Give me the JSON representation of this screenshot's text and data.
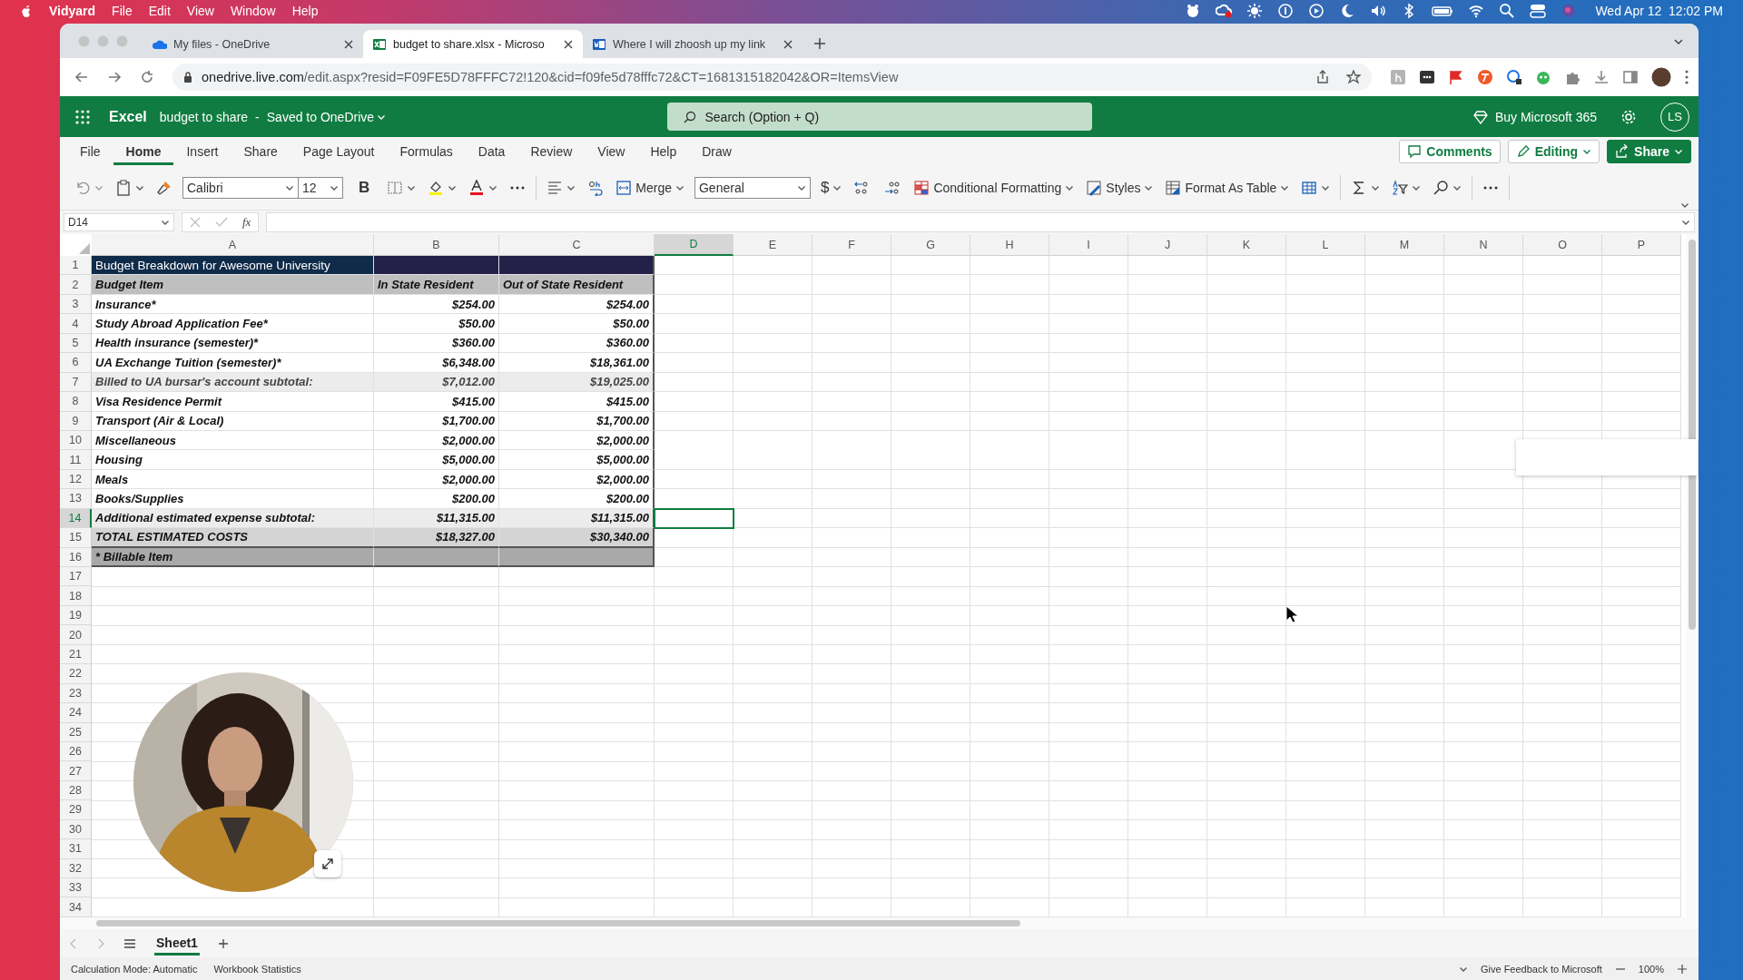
{
  "menubar": {
    "app": "Vidyard",
    "items": [
      "File",
      "Edit",
      "View",
      "Window",
      "Help"
    ],
    "clock": "Wed Apr 12  12:02 PM"
  },
  "browser": {
    "tabs": [
      {
        "title": "My files - OneDrive",
        "kind": "cloud",
        "selected": false
      },
      {
        "title": "budget to share.xlsx - Microso",
        "kind": "sheet",
        "selected": true
      },
      {
        "title": "Where I will zhoosh up my link",
        "kind": "doc",
        "selected": false
      }
    ],
    "url_host": "onedrive.live.com",
    "url_path": "/edit.aspx?resid=F09FE5D78FFFC72!120&cid=f09fe5d78fffc72&CT=1681315182042&OR=ItemsView"
  },
  "excel": {
    "app": "Excel",
    "document": "budget to share",
    "separator": "-",
    "save_status": "Saved to OneDrive",
    "search_placeholder": "Search (Option + Q)",
    "buy": "Buy Microsoft 365",
    "avatar": "LS"
  },
  "ribbon": {
    "tabs": [
      {
        "label": "File",
        "selected": false
      },
      {
        "label": "Home",
        "selected": true
      },
      {
        "label": "Insert",
        "selected": false
      },
      {
        "label": "Share",
        "selected": false
      },
      {
        "label": "Page Layout",
        "selected": false
      },
      {
        "label": "Formulas",
        "selected": false
      },
      {
        "label": "Data",
        "selected": false
      },
      {
        "label": "Review",
        "selected": false
      },
      {
        "label": "View",
        "selected": false
      },
      {
        "label": "Help",
        "selected": false
      },
      {
        "label": "Draw",
        "selected": false
      }
    ],
    "actions": [
      {
        "label": "Comments",
        "kind": "comments"
      },
      {
        "label": "Editing",
        "kind": "editing"
      },
      {
        "label": "Share",
        "kind": "share"
      }
    ]
  },
  "toolbar": {
    "font": "Calibri",
    "font_size": "12",
    "bold": "B",
    "merge": "Merge",
    "number_format": "General",
    "currency": "$",
    "conditional_formatting": "Conditional Formatting",
    "styles": "Styles",
    "format_as_table": "Format As Table"
  },
  "formula_bar": {
    "name_box": "D14",
    "function_label": "fx"
  },
  "sheet": {
    "columns": [
      {
        "label": "A",
        "selected": false
      },
      {
        "label": "B",
        "selected": false
      },
      {
        "label": "C",
        "selected": false
      },
      {
        "label": "D",
        "selected": true
      },
      {
        "label": "E",
        "selected": false
      },
      {
        "label": "F",
        "selected": false
      },
      {
        "label": "G",
        "selected": false
      },
      {
        "label": "H",
        "selected": false
      },
      {
        "label": "I",
        "selected": false
      },
      {
        "label": "J",
        "selected": false
      },
      {
        "label": "K",
        "selected": false
      },
      {
        "label": "L",
        "selected": false
      },
      {
        "label": "M",
        "selected": false
      },
      {
        "label": "N",
        "selected": false
      },
      {
        "label": "O",
        "selected": false
      },
      {
        "label": "P",
        "selected": false
      }
    ],
    "rows": [
      {
        "number": "1",
        "selected": false,
        "kind": "title",
        "cells": [
          "Budget Breakdown for Awesome University"
        ]
      },
      {
        "number": "2",
        "selected": false,
        "kind": "header",
        "cells": [
          "Budget Item",
          "In State Resident",
          "Out of State Resident"
        ]
      },
      {
        "number": "3",
        "selected": false,
        "kind": "item",
        "cells": [
          "Insurance*",
          "$254.00",
          "$254.00"
        ]
      },
      {
        "number": "4",
        "selected": false,
        "kind": "item",
        "cells": [
          "Study Abroad Application Fee*",
          "$50.00",
          "$50.00"
        ]
      },
      {
        "number": "5",
        "selected": false,
        "kind": "item",
        "cells": [
          "Health insurance (semester)*",
          "$360.00",
          "$360.00"
        ]
      },
      {
        "number": "6",
        "selected": false,
        "kind": "item",
        "cells": [
          "UA Exchange Tuition (semester)*",
          "$6,348.00",
          "$18,361.00"
        ]
      },
      {
        "number": "7",
        "selected": false,
        "kind": "subtotal",
        "cells": [
          "Billed to UA bursar's account subtotal:",
          "$7,012.00",
          "$19,025.00"
        ]
      },
      {
        "number": "8",
        "selected": false,
        "kind": "item",
        "cells": [
          "Visa Residence Permit",
          "$415.00",
          "$415.00"
        ]
      },
      {
        "number": "9",
        "selected": false,
        "kind": "item",
        "cells": [
          "Transport (Air & Local)",
          "$1,700.00",
          "$1,700.00"
        ]
      },
      {
        "number": "10",
        "selected": false,
        "kind": "item",
        "cells": [
          "Miscellaneous",
          "$2,000.00",
          "$2,000.00"
        ]
      },
      {
        "number": "11",
        "selected": false,
        "kind": "item",
        "cells": [
          "Housing",
          "$5,000.00",
          "$5,000.00"
        ]
      },
      {
        "number": "12",
        "selected": false,
        "kind": "item",
        "cells": [
          "Meals",
          "$2,000.00",
          "$2,000.00"
        ]
      },
      {
        "number": "13",
        "selected": false,
        "kind": "item",
        "cells": [
          "Books/Supplies",
          "$200.00",
          "$200.00"
        ]
      },
      {
        "number": "14",
        "selected": true,
        "kind": "subtotal2",
        "cells": [
          "Additional estimated expense subtotal:",
          "$11,315.00",
          "$11,315.00"
        ]
      },
      {
        "number": "15",
        "selected": false,
        "kind": "total",
        "cells": [
          "TOTAL ESTIMATED COSTS",
          "$18,327.00",
          "$30,340.00"
        ]
      },
      {
        "number": "16",
        "selected": false,
        "kind": "note",
        "cells": [
          "* Billable Item"
        ]
      },
      {
        "number": "17",
        "selected": false
      },
      {
        "number": "18",
        "selected": false
      },
      {
        "number": "19",
        "selected": false
      },
      {
        "number": "20",
        "selected": false
      },
      {
        "number": "21",
        "selected": false
      },
      {
        "number": "22",
        "selected": false
      },
      {
        "number": "23",
        "selected": false
      },
      {
        "number": "24",
        "selected": false
      },
      {
        "number": "25",
        "selected": false
      },
      {
        "number": "26",
        "selected": false
      },
      {
        "number": "27",
        "selected": false
      },
      {
        "number": "28",
        "selected": false
      },
      {
        "number": "29",
        "selected": false
      },
      {
        "number": "30",
        "selected": false
      },
      {
        "number": "31",
        "selected": false
      },
      {
        "number": "32",
        "selected": false
      },
      {
        "number": "33",
        "selected": false
      },
      {
        "number": "34",
        "selected": false
      }
    ]
  },
  "sheet_tabs": [
    {
      "label": "Sheet1",
      "selected": true
    }
  ],
  "status_bar": {
    "calculation_mode": "Calculation Mode: Automatic",
    "workbook_statistics": "Workbook Statistics",
    "feedback": "Give Feedback to Microsoft",
    "zoom": "100%"
  }
}
